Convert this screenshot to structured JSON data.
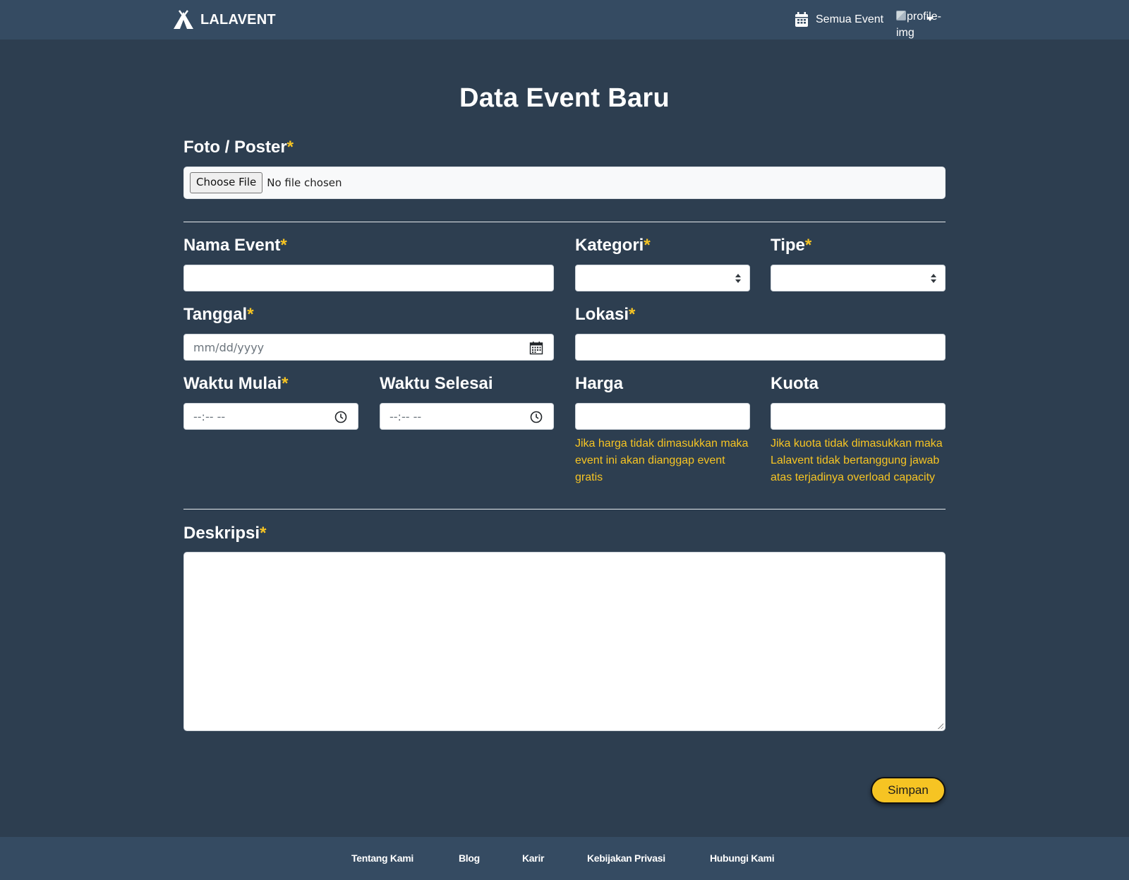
{
  "navbar": {
    "brand": "LALAVENT",
    "all_events": "Semua Event",
    "profile_img_alt": "profile-img"
  },
  "page": {
    "title": "Data Event Baru"
  },
  "form": {
    "required_mark": "*",
    "poster": {
      "label": "Foto / Poster",
      "button": "Choose File",
      "status": "No file chosen"
    },
    "nama_event": {
      "label": "Nama Event",
      "value": ""
    },
    "kategori": {
      "label": "Kategori",
      "value": ""
    },
    "tipe": {
      "label": "Tipe",
      "value": ""
    },
    "tanggal": {
      "label": "Tanggal",
      "placeholder": "mm/dd/yyyy"
    },
    "lokasi": {
      "label": "Lokasi",
      "value": ""
    },
    "waktu_mulai": {
      "label": "Waktu Mulai",
      "placeholder": "--:-- --"
    },
    "waktu_selesai": {
      "label": "Waktu Selesai",
      "placeholder": "--:-- --"
    },
    "harga": {
      "label": "Harga",
      "hint": "Jika harga tidak dimasukkan maka event ini akan dianggap event gratis"
    },
    "kuota": {
      "label": "Kuota",
      "hint": "Jika kuota tidak dimasukkan maka Lalavent tidak bertanggung jawab atas terjadinya overload capacity"
    },
    "deskripsi": {
      "label": "Deskripsi",
      "value": ""
    },
    "save_label": "Simpan"
  },
  "footer": {
    "links": [
      "Tentang Kami",
      "Blog",
      "Karir",
      "Kebijakan Privasi",
      "Hubungi Kami"
    ]
  },
  "colors": {
    "background": "#2d3e50",
    "navbar": "#354b62",
    "accent": "#f6c423"
  },
  "icons": {
    "brand": "tent-icon",
    "nav_events": "calendar-icon",
    "date": "calendar-icon",
    "time": "clock-icon",
    "dropdown": "caret-down-icon"
  }
}
